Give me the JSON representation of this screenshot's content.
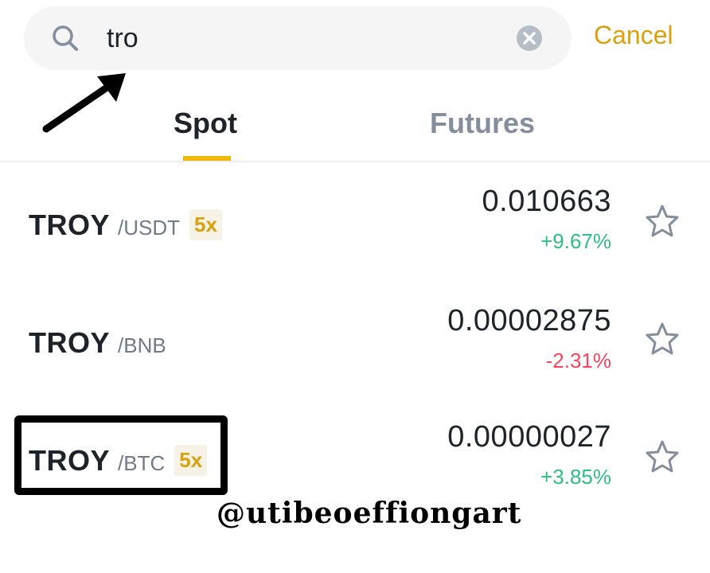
{
  "search": {
    "value": "tro",
    "cancel_label": "Cancel"
  },
  "tabs": [
    {
      "label": "Spot",
      "active": true
    },
    {
      "label": "Futures",
      "active": false
    }
  ],
  "markets": [
    {
      "base": "TROY",
      "quote": "/USDT",
      "leverage": "5x",
      "price": "0.010663",
      "change": "+9.67%",
      "direction": "up",
      "favorite": false
    },
    {
      "base": "TROY",
      "quote": "/BNB",
      "leverage": "",
      "price": "0.00002875",
      "change": "-2.31%",
      "direction": "down",
      "favorite": false
    },
    {
      "base": "TROY",
      "quote": "/BTC",
      "leverage": "5x",
      "price": "0.00000027",
      "change": "+3.85%",
      "direction": "up",
      "favorite": false
    }
  ],
  "watermark": "@utibeoeffiongart",
  "colors": {
    "accent": "#f0b90b",
    "cancel": "#d9a20c",
    "up": "#2ebd85",
    "down": "#f6465d",
    "text": "#1e2329",
    "muted": "#848e9c"
  },
  "icons": {
    "search": "search-icon",
    "clear": "clear-icon",
    "favorite": "star-icon"
  }
}
